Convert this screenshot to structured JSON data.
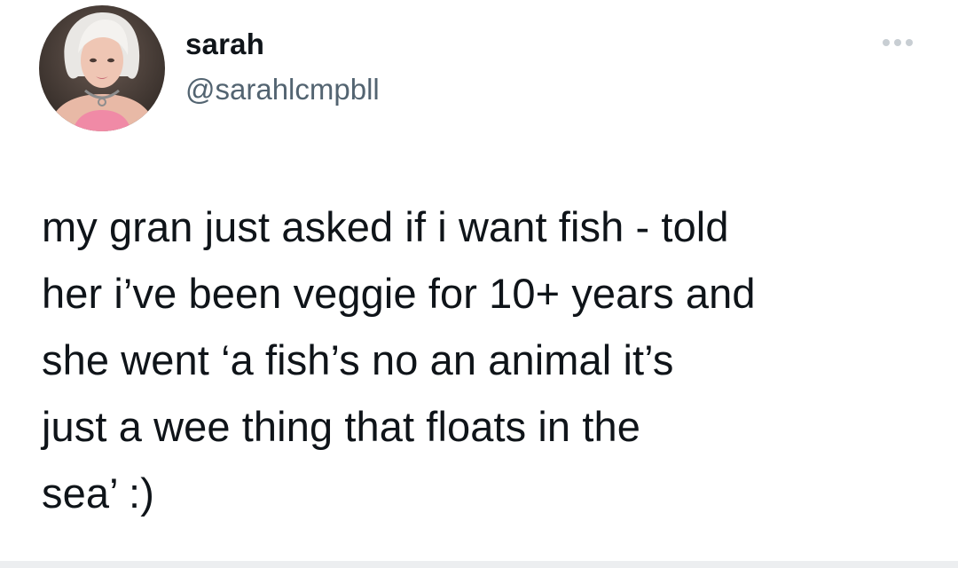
{
  "tweet": {
    "author": {
      "display_name": "sarah",
      "handle": "@sarahlcmpbll",
      "avatar_icon": "profile-photo"
    },
    "more_icon": "more-options-icon",
    "text_lines": [
      "my gran just asked if i want fish - told",
      "her i’ve been veggie for 10+ years and",
      "she went ‘a fish’s no an animal it’s",
      "just a wee thing that floats in the",
      "sea’ :)"
    ]
  },
  "colors": {
    "text_primary": "#0f1419",
    "text_secondary": "#536471",
    "background": "#ffffff"
  }
}
